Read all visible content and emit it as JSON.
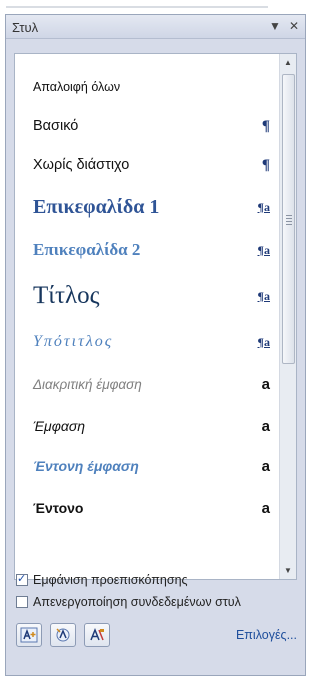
{
  "pane": {
    "title": "Στυλ",
    "dropdown_glyph": "▼",
    "close_glyph": "✕"
  },
  "styles": [
    {
      "name": "Απαλοιφή όλων",
      "mark": ""
    },
    {
      "name": "Βασικό",
      "mark": "¶"
    },
    {
      "name": "Χωρίς διάστιχο",
      "mark": "¶"
    },
    {
      "name": "Επικεφαλίδα 1",
      "mark": "¶a"
    },
    {
      "name": "Επικεφαλίδα 2",
      "mark": "¶a"
    },
    {
      "name": "Τίτλος",
      "mark": "¶a"
    },
    {
      "name": "Υπότιτλος",
      "mark": "¶a"
    },
    {
      "name": "Διακριτική έμφαση",
      "mark": "a"
    },
    {
      "name": "Έμφαση",
      "mark": "a"
    },
    {
      "name": "Έντονη έμφαση",
      "mark": "a"
    },
    {
      "name": "Έντονο",
      "mark": "a"
    }
  ],
  "options": {
    "show_preview": {
      "label": "Εμφάνιση προεπισκόπησης",
      "checked": true
    },
    "disable_linked": {
      "label": "Απενεργοποίηση συνδεδεμένων στυλ",
      "checked": false
    }
  },
  "toolbar": {
    "options_link": "Επιλογές..."
  },
  "colors": {
    "heading": "#2f5496",
    "heading2": "#4f81bd",
    "subtle": "#7f7f7f",
    "link": "#1e4e9c"
  }
}
